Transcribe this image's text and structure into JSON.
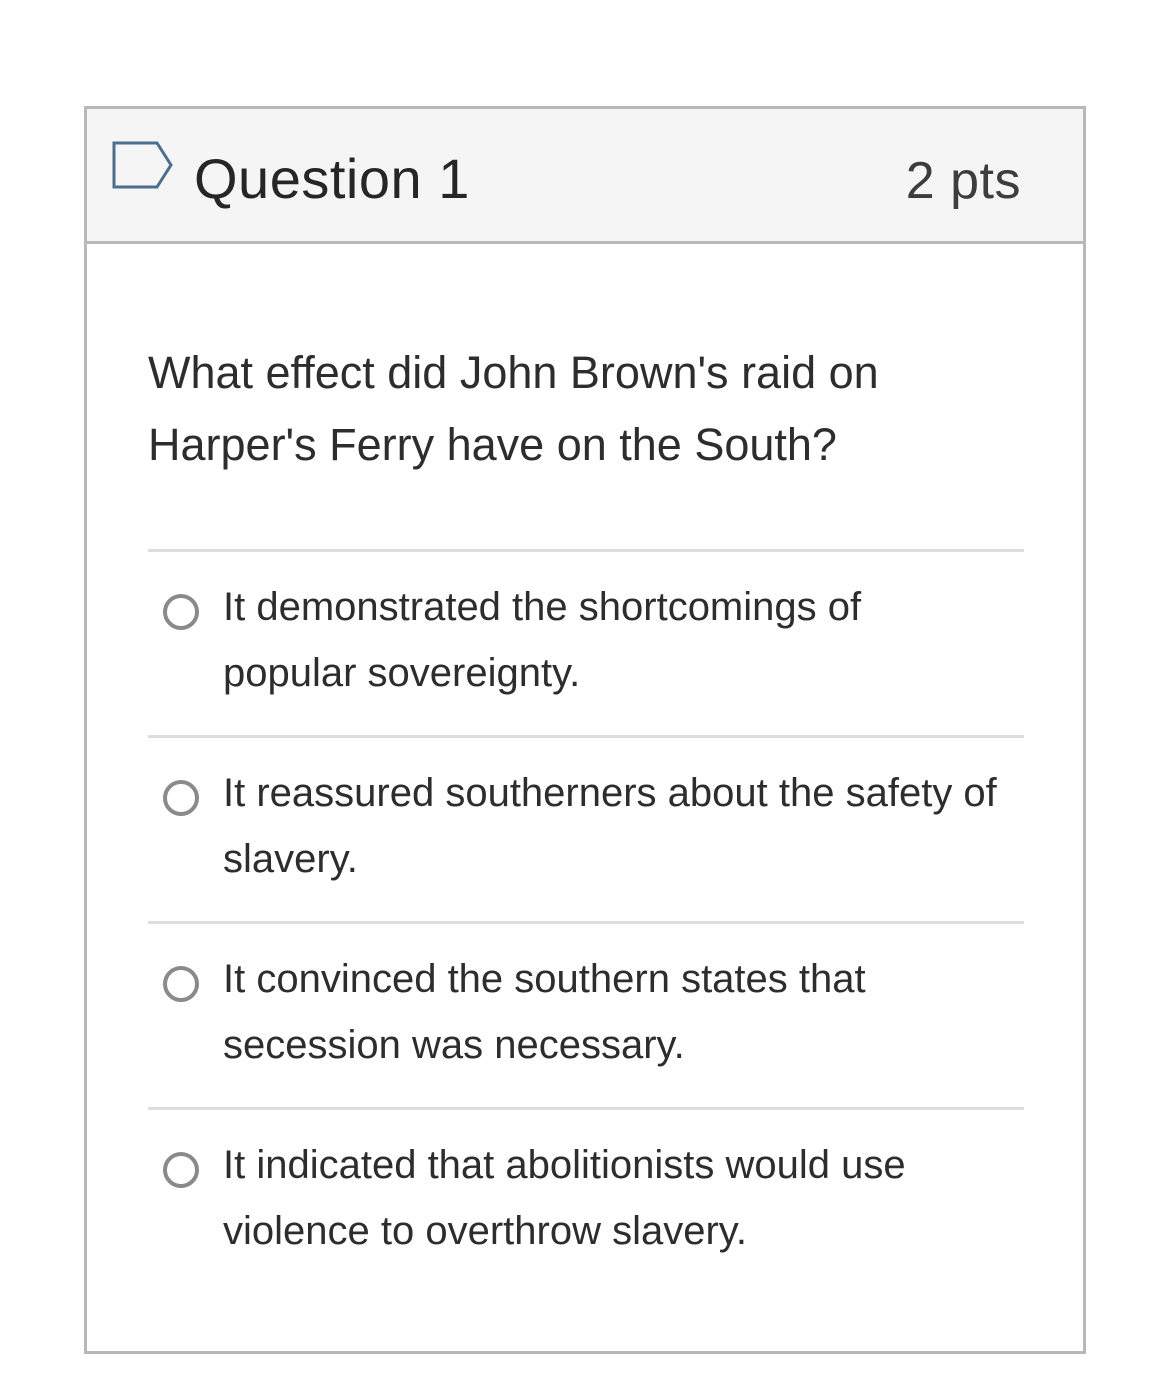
{
  "question": {
    "title": "Question 1",
    "points": "2 pts",
    "text": "What effect did John Brown's raid on Harper's Ferry have on the South?",
    "flag_icon": "flag-outline-icon",
    "answers": [
      {
        "label": "It demonstrated the shortcomings of popular sovereignty.",
        "selected": false
      },
      {
        "label": "It reassured southerners about the safety of slavery.",
        "selected": false
      },
      {
        "label": "It convinced the southern states that secession was necessary.",
        "selected": false
      },
      {
        "label": "It indicated that abolitionists would use violence to overthrow slavery.",
        "selected": false
      }
    ]
  },
  "colors": {
    "header_bg": "#f5f5f5",
    "border": "#b8b8b8",
    "divider": "#dddddd",
    "flag_stroke": "#4a6f8f",
    "radio_stroke": "#8a8a8a"
  }
}
